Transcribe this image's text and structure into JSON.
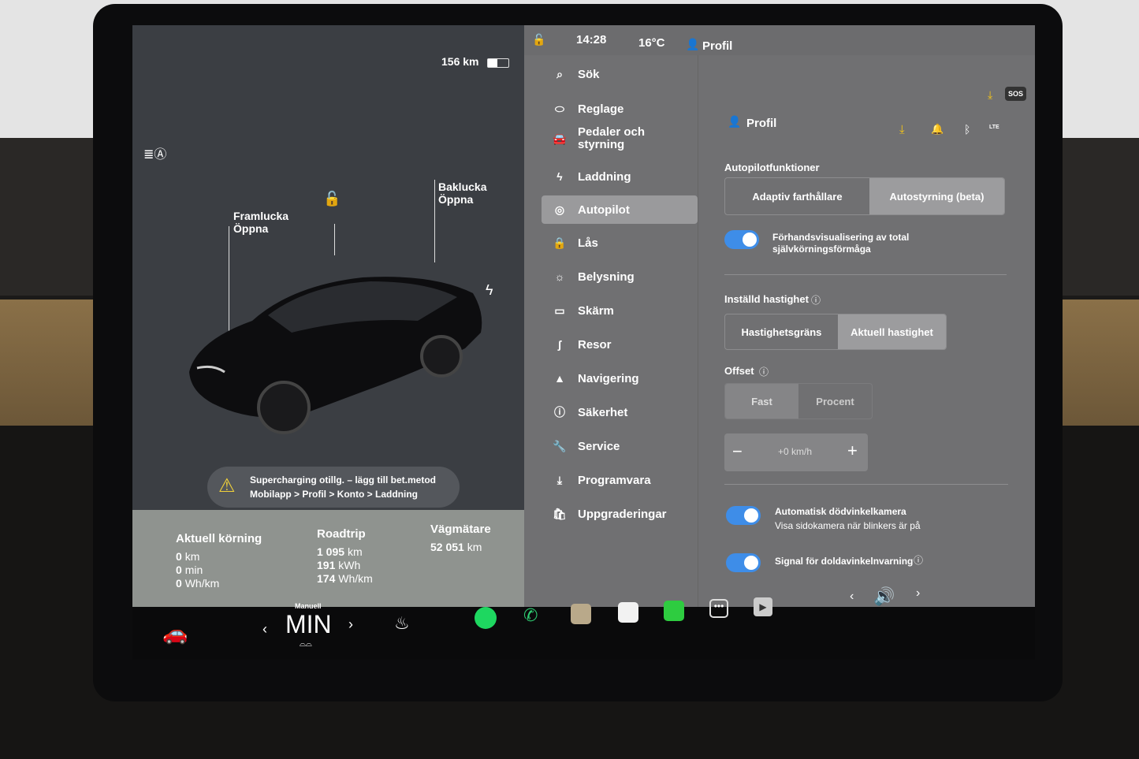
{
  "status": {
    "range": "156 km",
    "time": "14:28",
    "temp": "16°C",
    "profile": "Profil"
  },
  "left": {
    "front_trunk": "Framlucka\nÖppna",
    "rear_trunk": "Baklucka\nÖppna",
    "alert": {
      "title": "Supercharging otillg. – lägg till bet.metod",
      "path": "Mobilapp > Profil > Konto > Laddning"
    },
    "trips": [
      {
        "title": "Aktuell körning",
        "rows": [
          [
            "0",
            "km"
          ],
          [
            "0",
            "min"
          ],
          [
            "0",
            "Wh/km"
          ]
        ]
      },
      {
        "title": "Roadtrip",
        "rows": [
          [
            "1 095",
            "km"
          ],
          [
            "191",
            "kWh"
          ],
          [
            "174",
            "Wh/km"
          ]
        ]
      },
      {
        "title": "Vägmätare",
        "rows": [
          [
            "52 051",
            "km"
          ]
        ]
      }
    ]
  },
  "menu": [
    {
      "label": "Sök",
      "icon": "search-icon",
      "glyph": "⌕"
    },
    {
      "label": "Reglage",
      "icon": "toggle-icon",
      "glyph": "⬭"
    },
    {
      "label": "Pedaler och styrning",
      "icon": "car-icon",
      "glyph": "🚘"
    },
    {
      "label": "Laddning",
      "icon": "bolt-icon",
      "glyph": "ϟ"
    },
    {
      "label": "Autopilot",
      "icon": "steering-wheel-icon",
      "glyph": "◎",
      "active": true
    },
    {
      "label": "Lås",
      "icon": "lock-icon",
      "glyph": "🔒"
    },
    {
      "label": "Belysning",
      "icon": "sun-icon",
      "glyph": "☼"
    },
    {
      "label": "Skärm",
      "icon": "display-icon",
      "glyph": "▭"
    },
    {
      "label": "Resor",
      "icon": "trips-icon",
      "glyph": "ʃ"
    },
    {
      "label": "Navigering",
      "icon": "navigation-icon",
      "glyph": "▲"
    },
    {
      "label": "Säkerhet",
      "icon": "safety-icon",
      "glyph": "ⓘ"
    },
    {
      "label": "Service",
      "icon": "wrench-icon",
      "glyph": "🔧"
    },
    {
      "label": "Programvara",
      "icon": "download-icon",
      "glyph": "⤓"
    },
    {
      "label": "Uppgraderingar",
      "icon": "bag-icon",
      "glyph": "🛍"
    }
  ],
  "settings": {
    "profile": "Profil",
    "lte": "LTE",
    "autopilot_features": "Autopilotfunktioner",
    "features_options": [
      "Adaptiv farthållare",
      "Autostyrning (beta)"
    ],
    "fsd_preview": "Förhandsvisualisering av total självkörningsförmåga",
    "set_speed": "Inställd hastighet",
    "set_speed_options": [
      "Hastighetsgräns",
      "Aktuell hastighet"
    ],
    "offset": "Offset",
    "offset_options": [
      "Fast",
      "Procent"
    ],
    "offset_value": "+0 km/h",
    "blind_cam": "Automatisk dödvinkelkamera",
    "blind_cam_sub": "Visa sidokamera när blinkers är på",
    "blind_signal": "Signal för doldavinkelnvarning"
  },
  "taskbar": {
    "climate_mode": "Manuell",
    "climate_value": "MIN",
    "sos": "SOS"
  },
  "colors": {
    "accent": "#3e8de8",
    "warning": "#f2d23a",
    "download": "#f5c518",
    "spotify": "#1ed760",
    "phone": "#2ecc71"
  }
}
